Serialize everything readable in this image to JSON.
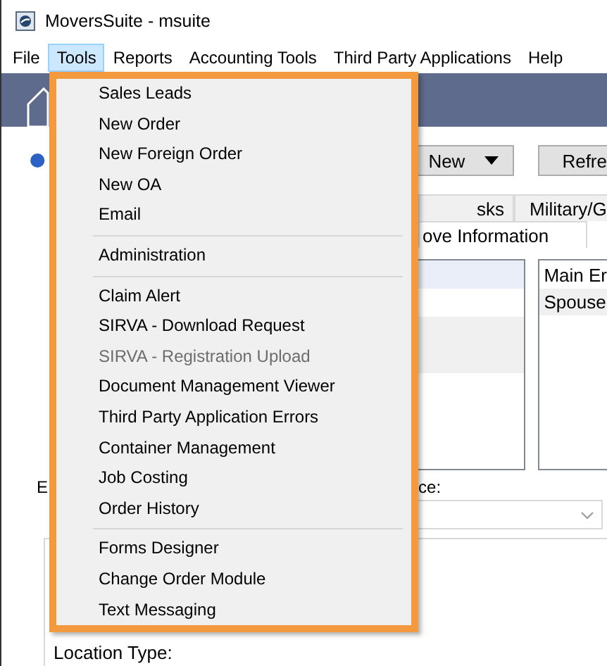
{
  "window": {
    "title": "MoversSuite - msuite"
  },
  "menu_bar": [
    {
      "label": "File",
      "selected": false
    },
    {
      "label": "Tools",
      "selected": true
    },
    {
      "label": "Reports",
      "selected": false
    },
    {
      "label": "Accounting Tools",
      "selected": false
    },
    {
      "label": "Third Party Applications",
      "selected": false
    },
    {
      "label": "Help",
      "selected": false
    }
  ],
  "toolbar": {
    "buttons": [
      {
        "label": "New",
        "kind": "dropdown"
      },
      {
        "label": "Refre",
        "kind": "plain"
      }
    ]
  },
  "tabs": {
    "row_1": [
      {
        "label": "sks",
        "selected": false
      },
      {
        "label": "Military/G",
        "selected": false
      }
    ],
    "row_2": [
      {
        "label": "ove Information",
        "selected": true
      }
    ]
  },
  "contacts": [
    "Main Er",
    "Spouse"
  ],
  "form": {
    "label_1": "E",
    "label_2": "ce:",
    "location_type_label": "Location Type:"
  },
  "tools_menu": {
    "groups": [
      [
        {
          "label": "Sales Leads",
          "disabled": false
        },
        {
          "label": "New Order",
          "disabled": false
        },
        {
          "label": "New Foreign Order",
          "disabled": false
        },
        {
          "label": "New OA",
          "disabled": false
        },
        {
          "label": "Email",
          "disabled": false
        }
      ],
      [
        {
          "label": "Administration",
          "disabled": false
        }
      ],
      [
        {
          "label": "Claim Alert",
          "disabled": false
        },
        {
          "label": "SIRVA - Download Request",
          "disabled": false
        },
        {
          "label": "SIRVA - Registration Upload",
          "disabled": true
        },
        {
          "label": "Document Management Viewer",
          "disabled": false
        },
        {
          "label": "Third Party Application Errors",
          "disabled": false
        },
        {
          "label": "Container Management",
          "disabled": false
        },
        {
          "label": "Job Costing",
          "disabled": false
        },
        {
          "label": "Order History",
          "disabled": false
        }
      ],
      [
        {
          "label": "Forms Designer",
          "disabled": false
        },
        {
          "label": "Change Order Module",
          "disabled": false
        },
        {
          "label": "Text Messaging",
          "disabled": false
        }
      ]
    ]
  }
}
